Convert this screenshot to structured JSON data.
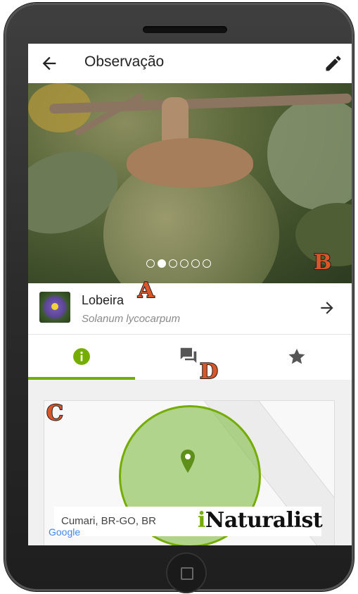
{
  "appbar": {
    "title": "Observação"
  },
  "photo": {
    "total": 6,
    "active_index": 1
  },
  "badges": {
    "a": "A",
    "b": "B",
    "c": "C",
    "d": "D"
  },
  "taxon": {
    "common_name": "Lobeira",
    "scientific_name": "Solanum lycocarpum"
  },
  "tabs": [
    {
      "icon": "info-icon",
      "active": true
    },
    {
      "icon": "comments-icon",
      "active": false
    },
    {
      "icon": "star-icon",
      "active": false
    }
  ],
  "map": {
    "location": "Cumari, BR-GO, BR",
    "attribution": "Google"
  },
  "brand": {
    "prefix": "i",
    "suffix": "Naturalist"
  },
  "colors": {
    "accent": "#74ac00",
    "badge": "#d9552a"
  }
}
